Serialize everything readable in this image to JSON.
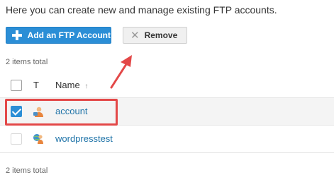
{
  "intro_text": "Here you can create new and manage existing FTP accounts.",
  "toolbar": {
    "add_label": "Add an FTP Account",
    "remove_label": "Remove"
  },
  "items_total_top": "2 items total",
  "items_total_bottom": "2 items total",
  "table": {
    "headers": {
      "type": "T",
      "name": "Name",
      "sort_glyph": "↑"
    },
    "rows": [
      {
        "name": "account",
        "checked": true,
        "icon": "ftp-user-icon"
      },
      {
        "name": "wordpresstest",
        "checked": false,
        "icon": "ftp-user-globe-icon"
      }
    ]
  },
  "colors": {
    "primary": "#2b8ed6",
    "link": "#1e73a8",
    "annotation": "#e34848"
  }
}
